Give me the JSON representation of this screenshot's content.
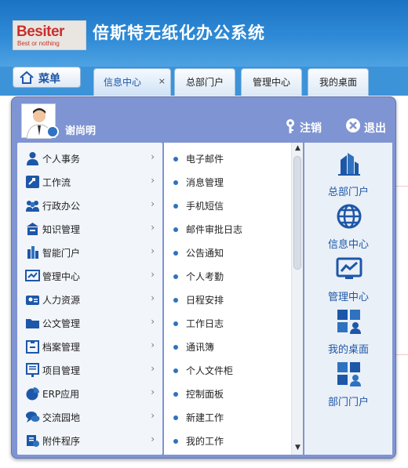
{
  "header": {
    "logo_text": "Besiter",
    "logo_tagline": "Best or nothing",
    "app_title": "倍斯特无纸化办公系统"
  },
  "menu_button": {
    "label": "菜单"
  },
  "tabs": [
    {
      "label": "信息中心",
      "active": true,
      "close": "×"
    },
    {
      "label": "总部门户"
    },
    {
      "label": "管理中心"
    },
    {
      "label": "我的桌面"
    }
  ],
  "panel": {
    "user_name": "谢尚明",
    "logout_label": "注销",
    "exit_label": "退出",
    "categories": [
      {
        "label": "个人事务",
        "icon": "person-icon"
      },
      {
        "label": "工作流",
        "icon": "workflow-icon"
      },
      {
        "label": "行政办公",
        "icon": "group-icon"
      },
      {
        "label": "知识管理",
        "icon": "knowledge-icon"
      },
      {
        "label": "智能门户",
        "icon": "portal-icon"
      },
      {
        "label": "管理中心",
        "icon": "chart-icon"
      },
      {
        "label": "人力资源",
        "icon": "hr-icon"
      },
      {
        "label": "公文管理",
        "icon": "folder-icon"
      },
      {
        "label": "档案管理",
        "icon": "archive-icon"
      },
      {
        "label": "项目管理",
        "icon": "project-icon"
      },
      {
        "label": "ERP应用",
        "icon": "pie-icon"
      },
      {
        "label": "交流园地",
        "icon": "chat-icon"
      },
      {
        "label": "附件程序",
        "icon": "attachment-icon"
      }
    ],
    "subitems": [
      "电子邮件",
      "消息管理",
      "手机短信",
      "邮件审批日志",
      "公告通知",
      "个人考勤",
      "日程安排",
      "工作日志",
      "通讯簿",
      "个人文件柜",
      "控制面板",
      "新建工作",
      "我的工作"
    ],
    "quick_links": [
      {
        "label": "总部门户",
        "icon": "building-icon"
      },
      {
        "label": "信息中心",
        "icon": "globe-icon"
      },
      {
        "label": "管理中心",
        "icon": "monitor-chart-icon"
      },
      {
        "label": "我的桌面",
        "icon": "desktop-user-icon"
      },
      {
        "label": "部门门户",
        "icon": "department-icon"
      }
    ]
  },
  "colors": {
    "header_blue": "#2e8ad6",
    "panel_blue": "#7f94d2",
    "link_blue": "#1d57a8",
    "bullet_blue": "#2f72c0",
    "logo_red": "#c9302c"
  }
}
